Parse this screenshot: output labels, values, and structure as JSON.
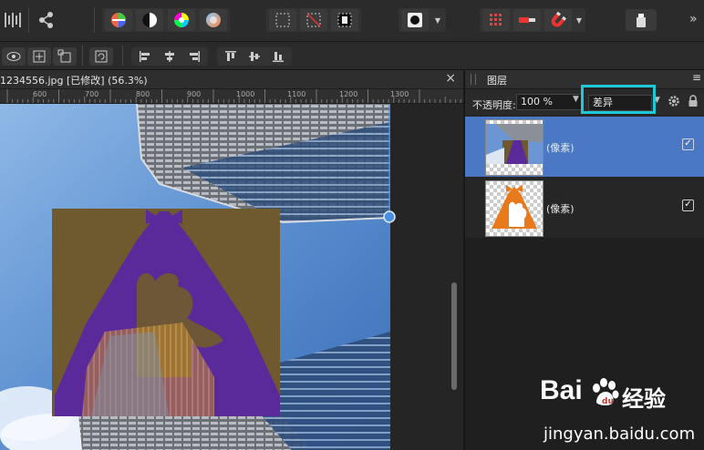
{
  "document": {
    "title": "1234556.jpg [已修改] (56.3%)",
    "close_glyph": "×"
  },
  "ruler": {
    "ticks": [
      "600",
      "700",
      "800",
      "900",
      "1000",
      "1100",
      "1200",
      "1300"
    ]
  },
  "panel": {
    "tab_label": "图层",
    "menu_glyph": "≡",
    "opacity_label": "不透明度:",
    "opacity_value": "100 %",
    "blend_mode": "差异",
    "layers": [
      {
        "name": "(像素)",
        "visible": true,
        "selected": true
      },
      {
        "name": "(像素)",
        "visible": true,
        "selected": false
      }
    ],
    "check_glyph": "✓"
  },
  "toolbar": {
    "more_glyph": "»"
  },
  "watermark": {
    "brand": "Bai",
    "brand_suffix": "经验",
    "url": "jingyan.baidu.com"
  },
  "colors": {
    "accent_highlight": "#1ec8d6",
    "selected_layer": "#4a78c4"
  }
}
